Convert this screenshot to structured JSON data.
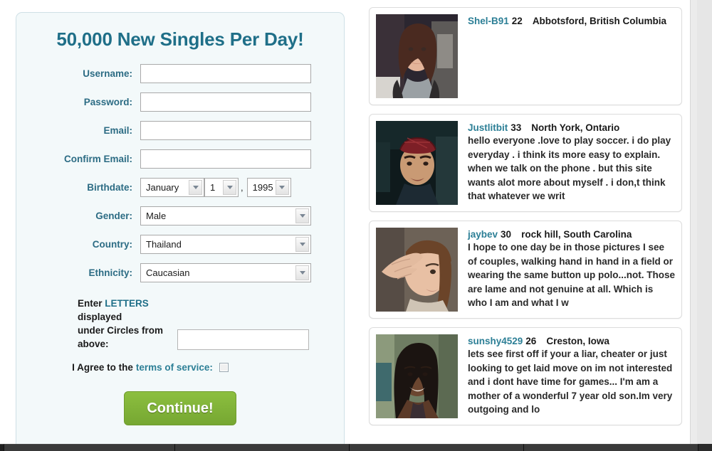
{
  "signup": {
    "title": "50,000 New Singles Per Day!",
    "fields": [
      {
        "label": "Username:",
        "name": "username",
        "value": "",
        "placeholder": ""
      },
      {
        "label": "Password:",
        "name": "password",
        "value": "",
        "placeholder": ""
      },
      {
        "label": "Email:",
        "name": "email",
        "value": "",
        "placeholder": ""
      },
      {
        "label": "Confirm Email:",
        "name": "confirm-email",
        "value": "",
        "placeholder": ""
      }
    ],
    "birthdate": {
      "label": "Birthdate:",
      "month": "January",
      "day": "1",
      "separator": ",",
      "year": "1995"
    },
    "gender": {
      "label": "Gender:",
      "value": "Male"
    },
    "country": {
      "label": "Country:",
      "value": "Thailand"
    },
    "ethnicity": {
      "label": "Ethnicity:",
      "value": "Caucasian"
    },
    "captcha": {
      "line1_prefix": "Enter ",
      "line1_emphasis": "LETTERS",
      "line2": "displayed",
      "line3": "under Circles from",
      "line4": "above:",
      "input_value": "",
      "input_placeholder": ""
    },
    "terms": {
      "text": "I Agree to the",
      "link": "terms of service:",
      "checked": false
    },
    "submit_label": "Continue!"
  },
  "profiles": [
    {
      "username": "Shel-B91",
      "age": "22",
      "location": "Abbotsford, British Columbia",
      "blurb": "",
      "photo_alt": "profile-photo-shel-b91"
    },
    {
      "username": "Justlitbit",
      "age": "33",
      "location": "North York, Ontario",
      "blurb": "hello everyone .love to play soccer. i do play everyday . i think its more easy to explain. when we talk on the phone . but this site wants alot more about myself . i don,t think that whatever we writ",
      "photo_alt": "profile-photo-justlitbit"
    },
    {
      "username": "jaybev",
      "age": "30",
      "location": "rock hill, South Carolina",
      "blurb": "I hope to one day be in those pictures I see of couples, walking hand in hand in a field or wearing the same button up polo...not. Those are lame and not genuine at all. Which is who I am and what I w",
      "photo_alt": "profile-photo-jaybev"
    },
    {
      "username": "sunshy4529",
      "age": "26",
      "location": "Creston, Iowa",
      "blurb": "lets see first off if your a liar, cheater or just looking to get laid move on im not interested and i dont have time for games... I'm am a mother of a wonderful 7 year old son.Im very outgoing and lo",
      "photo_alt": "profile-photo-sunshy4529"
    }
  ],
  "colors": {
    "heading": "#1f6f88",
    "label": "#2c6c84",
    "link": "#2c7f96",
    "submit_bg": "#7ead36",
    "panel_bg": "#f3f9fa"
  }
}
